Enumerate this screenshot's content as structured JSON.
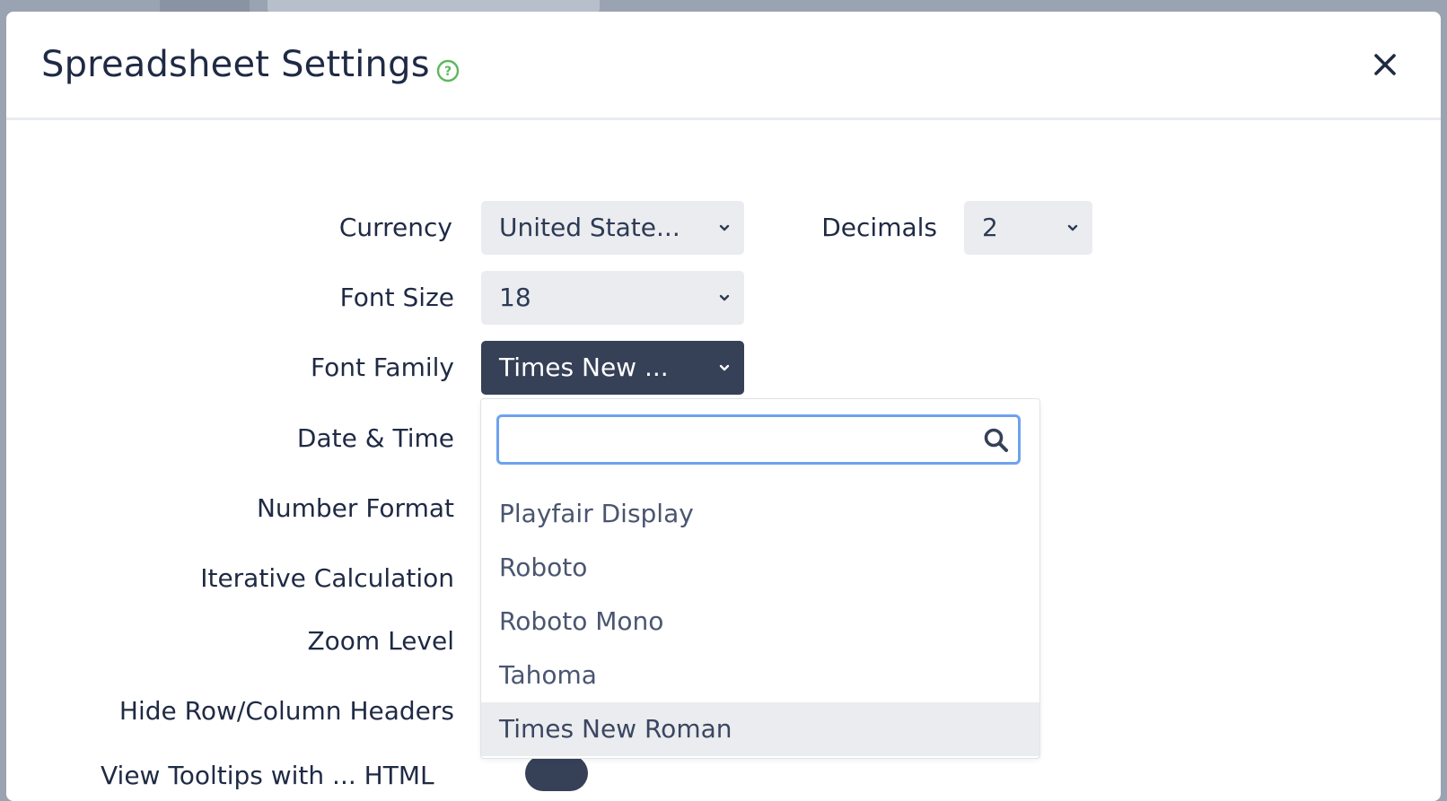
{
  "modal": {
    "title": "Spreadsheet Settings",
    "help_icon": "question-circle-icon",
    "close_icon": "close-icon"
  },
  "settings": {
    "currency": {
      "label": "Currency",
      "value": "United State..."
    },
    "decimals": {
      "label": "Decimals",
      "value": "2"
    },
    "font_size": {
      "label": "Font Size",
      "value": "18"
    },
    "font_family": {
      "label": "Font Family",
      "value": "Times New ..."
    },
    "date_time": {
      "label": "Date & Time"
    },
    "number_format": {
      "label": "Number Format"
    },
    "iterative_calculation": {
      "label": "Iterative Calculation"
    },
    "zoom_level": {
      "label": "Zoom Level"
    },
    "hide_headers": {
      "label": "Hide Row/Column Headers"
    },
    "partial_row": {
      "label": "View Tooltips with ... HTML"
    }
  },
  "dropdown": {
    "search_placeholder": "",
    "options": [
      "Playfair Display",
      "Roboto",
      "Roboto Mono",
      "Tahoma",
      "Times New Roman"
    ],
    "selected": "Times New Roman"
  },
  "colors": {
    "accent_dark": "#364057",
    "help_green": "#5cb85c",
    "search_focus": "#6ea2f0",
    "select_bg": "#ebecef"
  }
}
